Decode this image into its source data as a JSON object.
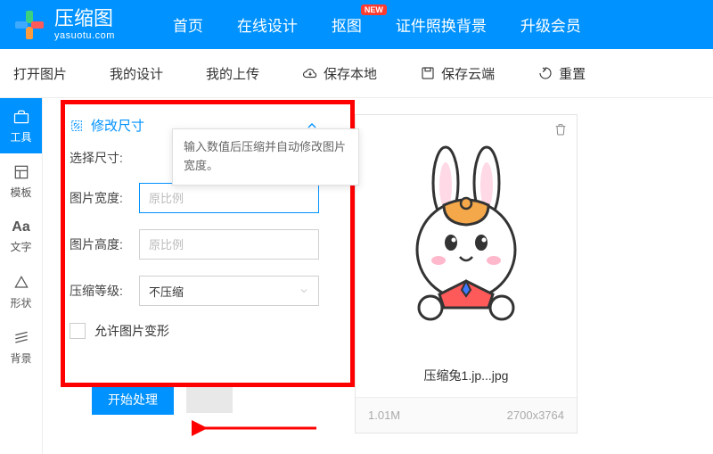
{
  "header": {
    "logo_cn": "压缩图",
    "logo_en": "yasuotu.com",
    "nav": [
      "首页",
      "在线设计",
      "抠图",
      "证件照换背景",
      "升级会员"
    ],
    "nav_badge": "NEW"
  },
  "toolbar": {
    "open": "打开图片",
    "mydesign": "我的设计",
    "myupload": "我的上传",
    "savelocal": "保存本地",
    "savecloud": "保存云端",
    "reset": "重置"
  },
  "sidebar": {
    "items": [
      "工具",
      "模板",
      "文字",
      "形状",
      "背景"
    ]
  },
  "panel": {
    "title": "修改尺寸",
    "tooltip": "输入数值后压缩并自动修改图片宽度。",
    "select_size_label": "选择尺寸:",
    "width_label": "图片宽度:",
    "width_placeholder": "原比例",
    "height_label": "图片高度:",
    "height_placeholder": "原比例",
    "compress_label": "压缩等级:",
    "compress_value": "不压缩",
    "allow_deform": "允许图片变形",
    "process_btn": "开始处理"
  },
  "preview": {
    "filename": "压缩兔1.jp...jpg",
    "size": "1.01M",
    "dimensions": "2700x3764"
  }
}
